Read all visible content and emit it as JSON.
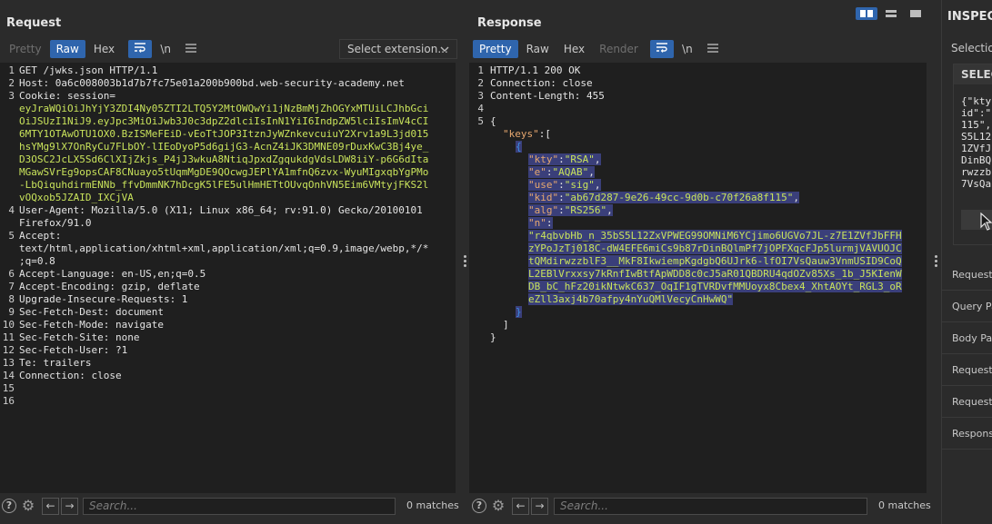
{
  "request": {
    "title": "Request",
    "view_tabs": [
      "Pretty",
      "Raw",
      "Hex"
    ],
    "active_tab": "Raw",
    "select_extension": "Select extension...",
    "lines": [
      {
        "n": "1",
        "text": "GET /jwks.json HTTP/1.1"
      },
      {
        "n": "2",
        "text": "Host: 0a6c008003b1d7b7fc75e01a200b900bd.web-security-academy.net"
      },
      {
        "n": "3",
        "text": "Cookie: session="
      },
      {
        "n": "",
        "text": "eyJraWQiOiJhYjY3ZDI4Ny05ZTI2LTQ5Y2MtOWQwYi1jNzBmMjZhOGYxMTUiLCJhbGci",
        "wrap": true
      },
      {
        "n": "",
        "text": "OiJSUzI1NiJ9.eyJpc3MiOiJwb3J0c3dpZ2dlciIsInN1YiI6IndpZW5lciIsImV4cCI",
        "wrap": true
      },
      {
        "n": "",
        "text": "6MTY1OTAwOTU1OX0.BzISMeFEiD-vEoTtJOP3ItznJyWZnkevcuiuY2Xrv1a9L3jd015",
        "wrap": true
      },
      {
        "n": "",
        "text": "hsYMg9lX7OnRyCu7FLbOY-lIEoDyoP5d6gijG3-AcnZ4iJK3DMNE09rDuxKwC3Bj4ye_",
        "wrap": true
      },
      {
        "n": "",
        "text": "D3OSC2JcLX5Sd6ClXIjZkjs_P4jJ3wkuA8NtiqJpxdZgqukdgVdsLDW8iiY-p6G6dIta",
        "wrap": true
      },
      {
        "n": "",
        "text": "MGawSVrEg9opsCAF8CNuayo5tUqmMgDE9QOcwgJEPlYA1mfnQ6zvx-WyuMIgxqbYgPMo",
        "wrap": true
      },
      {
        "n": "",
        "text": "-LbQiquhdirmENNb_ffvDmmNK7hDcgK5lFE5ulHmHETtOUvqOnhVN5Eim6VMtyjFKS2l",
        "wrap": true
      },
      {
        "n": "",
        "text": "vOQxob5JZAID_IXCjVA",
        "wrap": true
      },
      {
        "n": "4",
        "text": "User-Agent: Mozilla/5.0 (X11; Linux x86_64; rv:91.0) Gecko/20100101"
      },
      {
        "n": "",
        "text": "Firefox/91.0"
      },
      {
        "n": "5",
        "text": "Accept:"
      },
      {
        "n": "",
        "text": "text/html,application/xhtml+xml,application/xml;q=0.9,image/webp,*/*"
      },
      {
        "n": "",
        "text": ";q=0.8"
      },
      {
        "n": "6",
        "text": "Accept-Language: en-US,en;q=0.5"
      },
      {
        "n": "7",
        "text": "Accept-Encoding: gzip, deflate"
      },
      {
        "n": "8",
        "text": "Upgrade-Insecure-Requests: 1"
      },
      {
        "n": "9",
        "text": "Sec-Fetch-Dest: document"
      },
      {
        "n": "10",
        "text": "Sec-Fetch-Mode: navigate"
      },
      {
        "n": "11",
        "text": "Sec-Fetch-Site: none"
      },
      {
        "n": "12",
        "text": "Sec-Fetch-User: ?1"
      },
      {
        "n": "13",
        "text": "Te: trailers"
      },
      {
        "n": "14",
        "text": "Connection: close"
      },
      {
        "n": "15",
        "text": ""
      },
      {
        "n": "16",
        "text": ""
      }
    ],
    "search_placeholder": "Search...",
    "matches": "0 matches"
  },
  "response": {
    "title": "Response",
    "view_tabs": [
      "Pretty",
      "Raw",
      "Hex",
      "Render"
    ],
    "active_tab": "Pretty",
    "lines": [
      {
        "n": "1",
        "text": "HTTP/1.1 200 OK"
      },
      {
        "n": "2",
        "text": "Connection: close"
      },
      {
        "n": "3",
        "text": "Content-Length: 455"
      },
      {
        "n": "4",
        "text": ""
      },
      {
        "n": "5",
        "text": "{"
      }
    ],
    "json_lines": [
      {
        "indent": 1,
        "key": "\"keys\"",
        "rest": ":["
      },
      {
        "indent": 2,
        "brace": "{"
      },
      {
        "indent": 3,
        "key": "\"kty\"",
        "sep": ":",
        "val": "\"RSA\"",
        "tail": ","
      },
      {
        "indent": 3,
        "key": "\"e\"",
        "sep": ":",
        "val": "\"AQAB\"",
        "tail": ","
      },
      {
        "indent": 3,
        "key": "\"use\"",
        "sep": ":",
        "val": "\"sig\"",
        "tail": ","
      },
      {
        "indent": 3,
        "key": "\"kid\"",
        "sep": ":",
        "val": "\"ab67d287-9e26-49cc-9d0b-c70f26a8f115\"",
        "tail": ","
      },
      {
        "indent": 3,
        "key": "\"alg\"",
        "sep": ":",
        "val": "\"RS256\"",
        "tail": ","
      },
      {
        "indent": 3,
        "key": "\"n\"",
        "sep": ":",
        "val": "",
        "tail": ""
      },
      {
        "indent": 3,
        "val": "\"r4qbvbHb_n_35bS5L12ZxVPWEG99OMNiM6YCjimo6UGVo7JL-z7E1ZVfJbFFH"
      },
      {
        "indent": 3,
        "val": "zYPoJzTj018C-dW4EFE6miCs9b87rDinBQlmPf7jOPFXqcFJp5lurmjVAVUOJC"
      },
      {
        "indent": 3,
        "val": "tQMdirwzzblF3__MkF8IkwiempKgdgbQ6UJrk6-lfOI7VsQauw3VnmUSID9CoQ"
      },
      {
        "indent": 3,
        "val": "L2EBlVrxxsy7kRnfIwBtfApWDD8c0cJ5aR01QBDRU4qdOZv85Xs_1b_J5KIenW"
      },
      {
        "indent": 3,
        "val": "DB_bC_hFz20ikNtwkC637_OqIF1gTVRDvfMMUoyx8Cbex4_XhtAOYt_RGL3_oR"
      },
      {
        "indent": 3,
        "val": "eZll3axj4b70afpy4nYuQMlVecyCnHwWQ\""
      },
      {
        "indent": 2,
        "brace": "}"
      },
      {
        "indent": 1,
        "brace": "]"
      },
      {
        "indent": 0,
        "brace": "}"
      }
    ],
    "search_placeholder": "Search...",
    "matches": "0 matches"
  },
  "inspector": {
    "title": "INSPECTOR",
    "selection_label": "Selection",
    "box_head": "SELECTED",
    "box_lines": [
      "{\"kty",
      "id\":\"",
      "115\",",
      "S5L12",
      "1ZVfJ",
      "DinBQ",
      "rwzzb",
      "7VsQa"
    ],
    "sections": [
      "Request Attributes",
      "Query Parameters",
      "Body Parameters",
      "Request Cookies",
      "Request Headers",
      "Response Headers"
    ]
  },
  "colors": {
    "accent": "#2f65ad",
    "json_key": "#e7a86f",
    "json_string": "#c9e35b",
    "json_brace": "#3c8ee6",
    "selection": "#3a3f7a"
  }
}
